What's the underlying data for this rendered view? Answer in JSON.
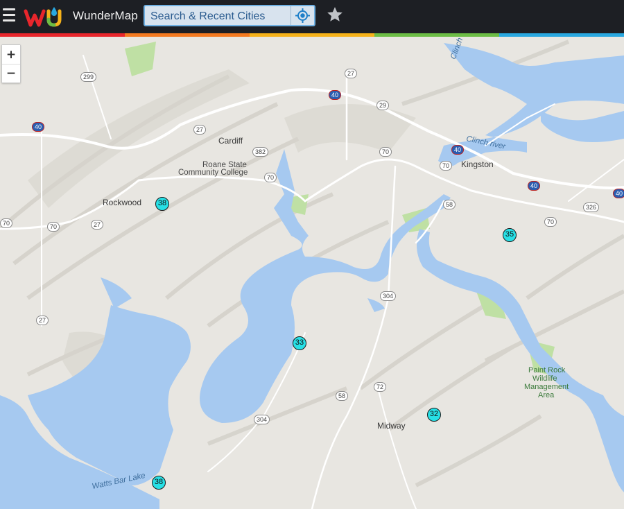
{
  "app": {
    "brand": "WunderMap"
  },
  "search": {
    "placeholder": "Search & Recent Cities"
  },
  "stripe_colors": [
    "#e8262c",
    "#f47a20",
    "#f6b21a",
    "#6cbd45",
    "#29a8e0"
  ],
  "colors": {
    "water": "#a6c9f0",
    "land": "#e8e6e1",
    "road": "#ffffff",
    "station": "#27e0e6",
    "park": "#bfe0a4"
  },
  "zoom": {
    "in": "+",
    "out": "−"
  },
  "places": [
    {
      "name": "Cardiff",
      "type": "city"
    },
    {
      "name": "Roane State",
      "type": "poi"
    },
    {
      "name": "Community College",
      "type": "poi"
    },
    {
      "name": "Kingston",
      "type": "city"
    },
    {
      "name": "Rockwood",
      "type": "city"
    },
    {
      "name": "Midway",
      "type": "city"
    },
    {
      "name": "Clinch river",
      "type": "water"
    },
    {
      "name": "Clinch River",
      "type": "water"
    },
    {
      "name": "Watts Bar Lake",
      "type": "water"
    },
    {
      "name": "Paint Rock",
      "type": "park"
    },
    {
      "name": "Wildlife",
      "type": "park"
    },
    {
      "name": "Management",
      "type": "park"
    },
    {
      "name": "Area",
      "type": "park"
    }
  ],
  "stations": [
    {
      "temp": "38"
    },
    {
      "temp": "35"
    },
    {
      "temp": "33"
    },
    {
      "temp": "32"
    },
    {
      "temp": "38"
    }
  ],
  "routes": [
    "299",
    "27",
    "40",
    "29",
    "27",
    "382",
    "70",
    "70",
    "70",
    "40",
    "70",
    "58",
    "40",
    "326",
    "70",
    "70",
    "27",
    "27",
    "304",
    "304",
    "72",
    "58",
    "40",
    "40"
  ]
}
